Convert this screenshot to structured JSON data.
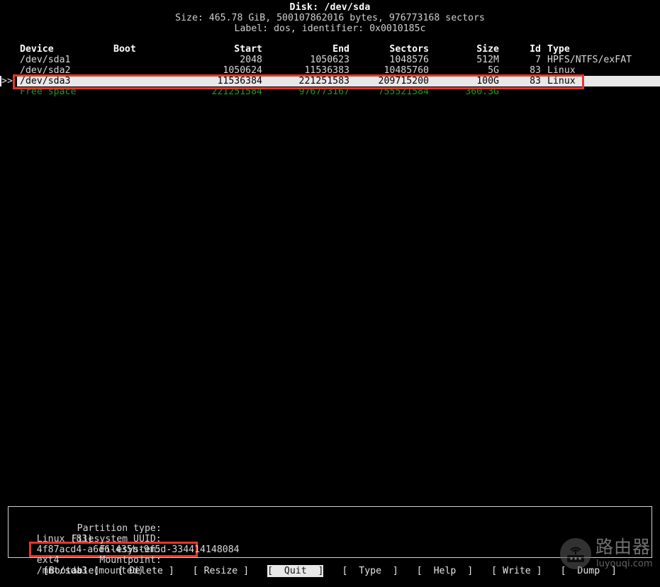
{
  "disk": {
    "title": "Disk: /dev/sda",
    "size_line": "Size: 465.78 GiB, 500107862016 bytes, 976773168 sectors",
    "label_line": "Label: dos, identifier: 0x0010185c"
  },
  "table": {
    "headers": {
      "device": "Device",
      "boot": "Boot",
      "start": "Start",
      "end": "End",
      "sectors": "Sectors",
      "size": "Size",
      "id": "Id",
      "type": "Type"
    },
    "cursor_marker": ">>",
    "rows": [
      {
        "cursor": "",
        "device": "/dev/sda1",
        "boot": "",
        "start": "2048",
        "end": "1050623",
        "sectors": "1048576",
        "size": "512M",
        "id": "7",
        "type": "HPFS/NTFS/exFAT",
        "selected": false,
        "free": false
      },
      {
        "cursor": "",
        "device": "/dev/sda2",
        "boot": "",
        "start": "1050624",
        "end": "11536383",
        "sectors": "10485760",
        "size": "5G",
        "id": "83",
        "type": "Linux",
        "selected": false,
        "free": false
      },
      {
        "cursor": ">>",
        "device": "/dev/sda3",
        "boot": "",
        "start": "11536384",
        "end": "221251583",
        "sectors": "209715200",
        "size": "100G",
        "id": "83",
        "type": "Linux",
        "selected": true,
        "free": false
      },
      {
        "cursor": "",
        "device": "Free space",
        "boot": "",
        "start": "221251584",
        "end": "976773167",
        "sectors": "755521584",
        "size": "360.3G",
        "id": "",
        "type": "",
        "selected": false,
        "free": true
      }
    ]
  },
  "info": {
    "lines": [
      {
        "label": "Partition type:",
        "value": "Linux (83)"
      },
      {
        "label": "Filesystem UUID:",
        "value": "4f87acd4-a6d6-435b-9f5d-334414148084"
      },
      {
        "label": "Filesystem:",
        "value": "ext4"
      },
      {
        "label": "Mountpoint:",
        "value": "/mnt/sda3 (mounted)"
      }
    ]
  },
  "menu": {
    "items": [
      {
        "label": "[Bootable]",
        "active": false
      },
      {
        "label": "[ Delete ]",
        "active": false
      },
      {
        "label": "[ Resize ]",
        "active": false
      },
      {
        "label": "[  Quit  ]",
        "active": true
      },
      {
        "label": "[  Type  ]",
        "active": false
      },
      {
        "label": "[  Help  ]",
        "active": false
      },
      {
        "label": "[ Write ]",
        "active": false
      },
      {
        "label": "[  Dump  ]",
        "active": false
      }
    ]
  },
  "watermark": {
    "cn_text": "路由器",
    "url_text": "luyouqi.com",
    "icon": "router-icon"
  },
  "colors": {
    "background": "#000000",
    "foreground": "#d8d8d8",
    "free_space": "#14a014",
    "selection_bg": "#e8e8e8",
    "annotation": "#e8352b"
  }
}
